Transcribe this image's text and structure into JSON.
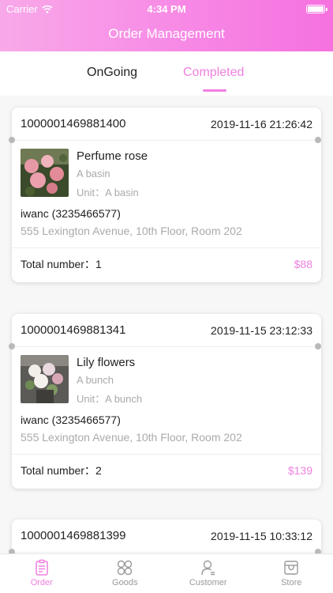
{
  "status_bar": {
    "carrier": "Carrier",
    "time": "4:34 PM"
  },
  "header": {
    "title": "Order Management"
  },
  "tabs": [
    {
      "label": "OnGoing",
      "active": false
    },
    {
      "label": "Completed",
      "active": true
    }
  ],
  "orders": [
    {
      "order_no": "1000001469881400",
      "time": "2019-11-16 21:26:42",
      "product": {
        "name": "Perfume rose",
        "spec": "A basin",
        "unit_label": "Unit：",
        "unit": "A basin",
        "image": "rose-photo"
      },
      "customer": "iwanc (3235466577)",
      "address": "555 Lexington Avenue, 10th Floor, Room 202",
      "total_label": "Total number：",
      "total": "1",
      "price": "$88"
    },
    {
      "order_no": "1000001469881341",
      "time": "2019-11-15 23:12:33",
      "product": {
        "name": "Lily flowers",
        "spec": "A bunch",
        "unit_label": "Unit：",
        "unit": "A bunch",
        "image": "lily-photo"
      },
      "customer": "iwanc (3235466577)",
      "address": "555 Lexington Avenue, 10th Floor, Room 202",
      "total_label": "Total number：",
      "total": "2",
      "price": "$139"
    },
    {
      "order_no": "1000001469881399",
      "time": "2019-11-15 10:33:12"
    }
  ],
  "tabbar": [
    {
      "label": "Order",
      "icon": "order-icon",
      "active": true
    },
    {
      "label": "Goods",
      "icon": "goods-icon",
      "active": false
    },
    {
      "label": "Customer",
      "icon": "customer-icon",
      "active": false
    },
    {
      "label": "Store",
      "icon": "store-icon",
      "active": false
    }
  ],
  "colors": {
    "accent": "#f07fe0",
    "header_start": "#f8a9e9",
    "header_end": "#f571df"
  }
}
